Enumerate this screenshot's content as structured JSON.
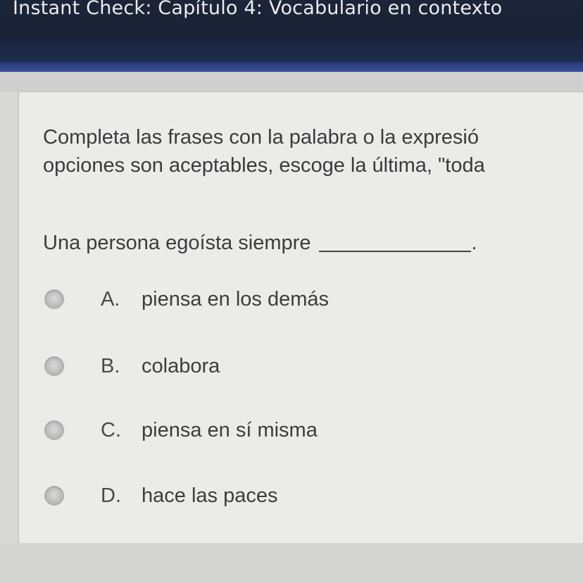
{
  "header": {
    "title": "Instant Check: Capítulo 4: Vocabulario en contexto"
  },
  "question": {
    "instructions_line1": "Completa las frases con la palabra o la expresió",
    "instructions_line2": "opciones son aceptables, escoge la última, \"toda",
    "prompt": "Una persona egoísta siempre",
    "prompt_end": ".",
    "options": [
      {
        "letter": "A.",
        "text": "piensa en los demás",
        "selected": false
      },
      {
        "letter": "B.",
        "text": "colabora",
        "selected": false
      },
      {
        "letter": "C.",
        "text": "piensa en sí misma",
        "selected": false
      },
      {
        "letter": "D.",
        "text": "hace las paces",
        "selected": false
      }
    ]
  },
  "colors": {
    "header_bg": "#1a2235",
    "accent_bar": "#3a4f9a",
    "card_bg": "#ebebea",
    "text": "#3d3d3d"
  }
}
